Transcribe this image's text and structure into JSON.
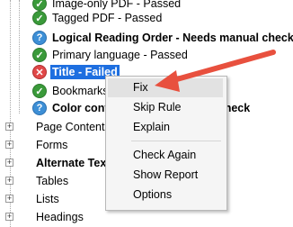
{
  "checks": [
    {
      "label": "Image-only PDF - Passed",
      "status": "passed",
      "bold": false
    },
    {
      "label": "Tagged PDF - Passed",
      "status": "passed",
      "bold": false
    },
    {
      "label": "Logical Reading Order - Needs manual check",
      "status": "manual",
      "bold": true
    },
    {
      "label": "Primary language - Passed",
      "status": "passed",
      "bold": false
    },
    {
      "label": "Title - Failed",
      "status": "failed",
      "bold": true,
      "selected": true
    },
    {
      "label": "Bookmarks - Passed",
      "status": "passed",
      "bold": false
    },
    {
      "label": "Color contrast - Needs manual check",
      "status": "manual",
      "bold": true
    }
  ],
  "status_glyphs": {
    "passed": "✓",
    "manual": "?",
    "failed": "✕"
  },
  "categories": [
    {
      "label": "Page Content",
      "bold": false
    },
    {
      "label": "Forms",
      "bold": false
    },
    {
      "label": "Alternate Text",
      "bold": true
    },
    {
      "label": "Tables",
      "bold": false
    },
    {
      "label": "Lists",
      "bold": false
    },
    {
      "label": "Headings",
      "bold": false
    }
  ],
  "context_menu": {
    "items": [
      "Fix",
      "Skip Rule",
      "Explain",
      "Check Again",
      "Show Report",
      "Options"
    ],
    "highlighted": "Fix"
  },
  "colors": {
    "selection": "#1e6fe0",
    "passed": "#3a9a3a",
    "manual": "#3d8fd6",
    "failed": "#e04848",
    "arrow": "#e8503e"
  }
}
